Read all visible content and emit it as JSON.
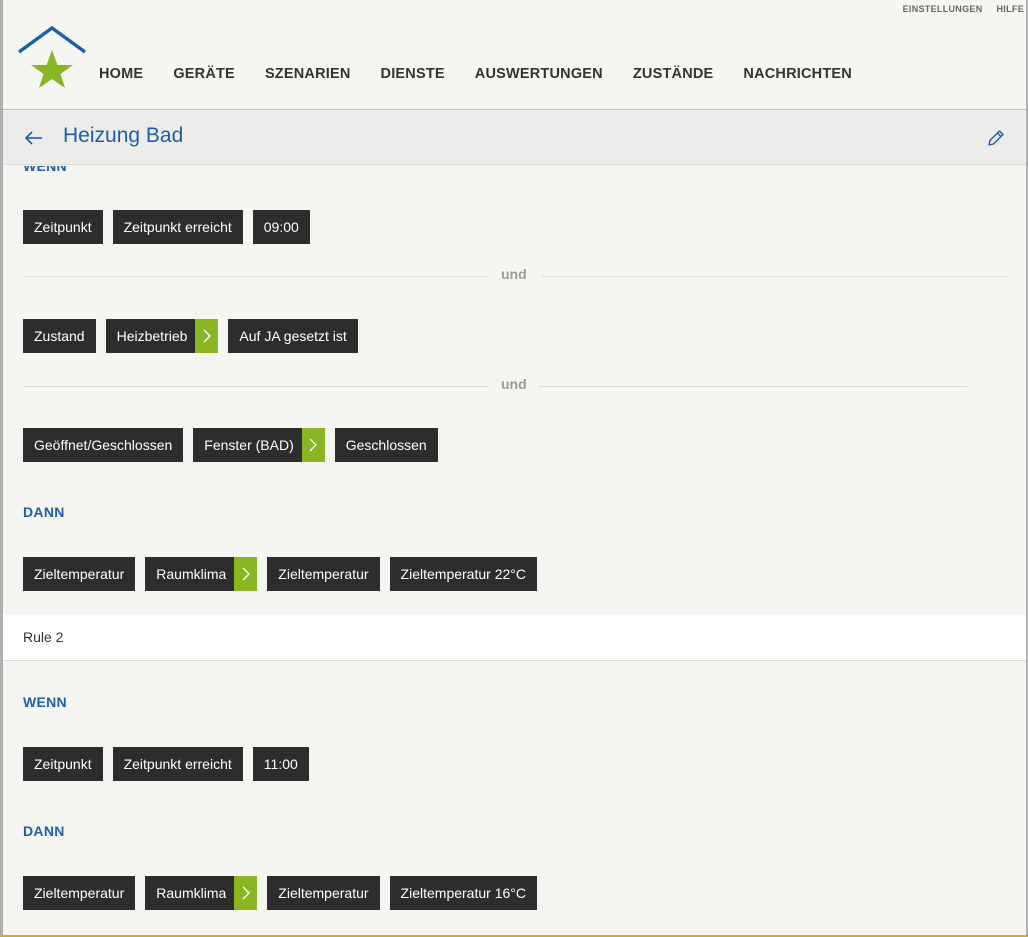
{
  "colors": {
    "accent_blue": "#1d5fa8",
    "accent_green": "#8ab623",
    "chip_bg": "#2d2d2d",
    "background": "#f5f5f2"
  },
  "toplinks": {
    "settings": "EINSTELLUNGEN",
    "help": "HILFE"
  },
  "nav": {
    "items": [
      "HOME",
      "GERÄTE",
      "SZENARIEN",
      "DIENSTE",
      "AUSWERTUNGEN",
      "ZUSTÄNDE",
      "NACHRICHTEN"
    ]
  },
  "titlebar": {
    "title": "Heizung Bad",
    "back_icon": "arrow-left-icon",
    "edit_icon": "pencil-icon"
  },
  "rule1": {
    "wenn_label": "WENN",
    "condition1": [
      "Zeitpunkt",
      "Zeitpunkt erreicht",
      "09:00"
    ],
    "and1": "und",
    "condition2": [
      "Zustand",
      "Heizbetrieb",
      "Auf JA gesetzt ist"
    ],
    "and2": "und",
    "condition3": [
      "Geöffnet/Geschlossen",
      "Fenster (BAD)",
      "Geschlossen"
    ],
    "dann_label": "DANN",
    "action1": [
      "Zieltemperatur",
      "Raumklima",
      "Zieltemperatur",
      "Zieltemperatur 22°C"
    ]
  },
  "rule2": {
    "name": "Rule 2",
    "wenn_label": "WENN",
    "condition1": [
      "Zeitpunkt",
      "Zeitpunkt erreicht",
      "11:00"
    ],
    "dann_label": "DANN",
    "action1": [
      "Zieltemperatur",
      "Raumklima",
      "Zieltemperatur",
      "Zieltemperatur 16°C"
    ]
  }
}
